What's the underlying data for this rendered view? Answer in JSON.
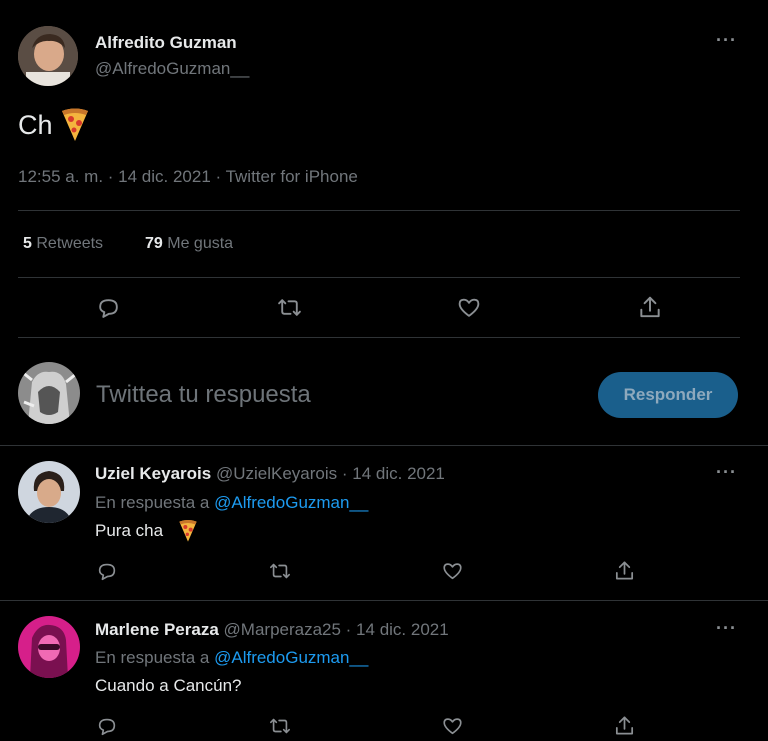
{
  "main_tweet": {
    "author_name": "Alfredito Guzman",
    "handle": "@AlfredoGuzman__",
    "more": "···",
    "text": "Ch",
    "emoji": "pizza",
    "meta": "12:55 a. m. · 14 dic. 2021 · Twitter for iPhone",
    "retweets_count": "5",
    "retweets_label": "Retweets",
    "likes_count": "79",
    "likes_label": "Me gusta"
  },
  "reply_box": {
    "placeholder": "Twittea tu respuesta",
    "button": "Responder"
  },
  "replies": [
    {
      "author_name": "Uziel Keyarois",
      "handle_date": "@UzielKeyarois · 14 dic. 2021",
      "more": "···",
      "reply_prefix": "En respuesta a",
      "reply_to": "@AlfredoGuzman__",
      "text": "Pura cha",
      "emoji": "pizza"
    },
    {
      "author_name": "Marlene Peraza",
      "handle_date": "@Marperaza25 · 14 dic. 2021",
      "more": "···",
      "reply_prefix": "En respuesta a",
      "reply_to": "@AlfredoGuzman__",
      "text": "Cuando a Cancún?"
    }
  ],
  "icons": [
    "comment-icon",
    "retweet-icon",
    "heart-icon",
    "share-icon"
  ],
  "colors": {
    "background": "#000000",
    "link": "#1d9bf0",
    "button": "#1a5f8c",
    "separator": "#2f3336"
  }
}
